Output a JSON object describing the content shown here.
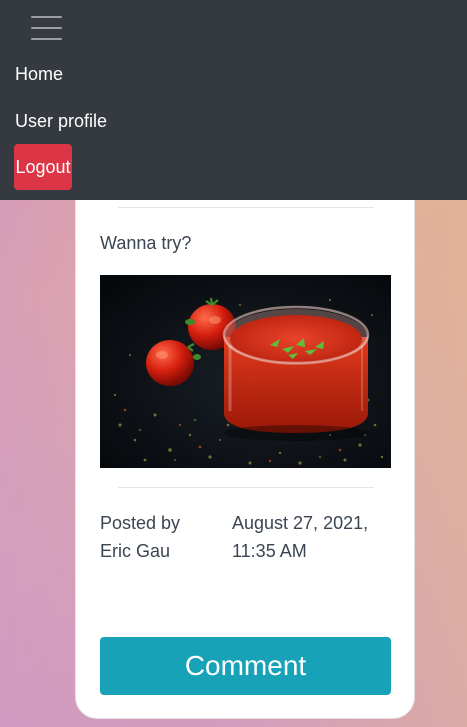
{
  "nav": {
    "toggler_icon": "hamburger-menu-icon",
    "items": [
      {
        "label": "Home"
      },
      {
        "label": "User profile"
      }
    ],
    "logout_label": "Logout",
    "logout_color": "#dc3545",
    "background": "#343a40"
  },
  "post": {
    "text": "Wanna try?",
    "image_subject": "jar of tomato sauce with tomatoes and herbs on dark background",
    "posted_by_label": "Posted by",
    "author": "Eric Gau",
    "date_line1": "August 27, 2021,",
    "date_line2": "11:35 AM"
  },
  "actions": {
    "comment_label": "Comment",
    "comment_color": "#17a2b8"
  }
}
